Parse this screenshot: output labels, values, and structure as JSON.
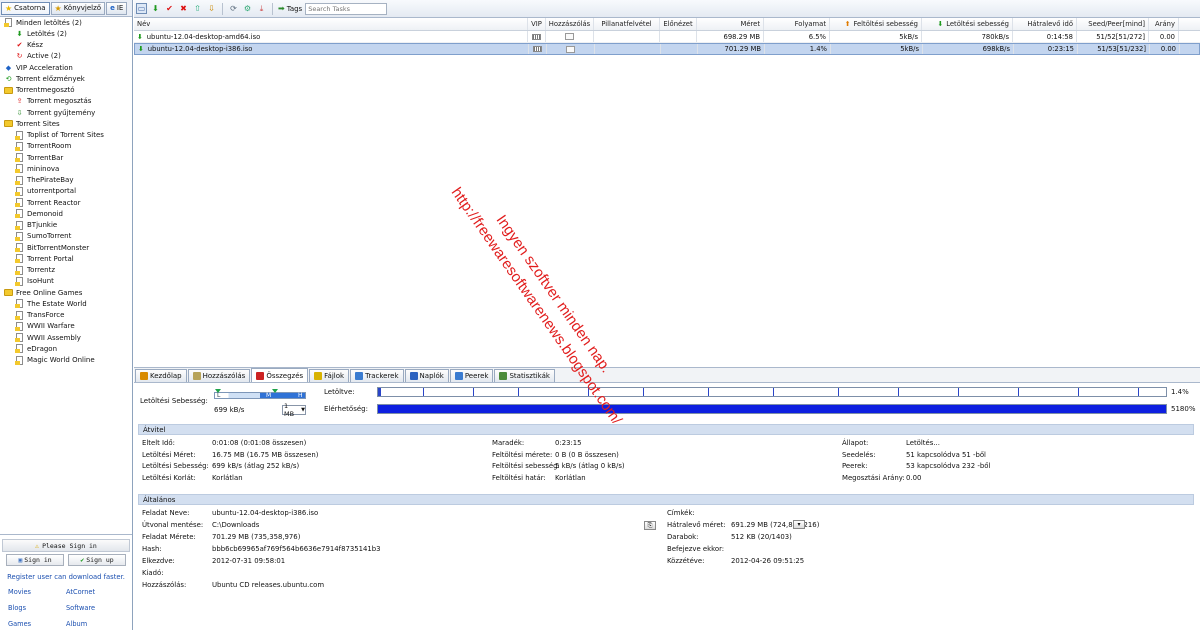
{
  "sidebar": {
    "tabs": [
      {
        "label": "Csatorna",
        "icon": "star-icon"
      },
      {
        "label": "Könyvjelző",
        "icon": "bookmark-icon"
      },
      {
        "label": "IE",
        "icon": "ie-icon"
      }
    ],
    "tree": [
      {
        "label": "Minden letöltés (2)",
        "level": 0,
        "icon": "page-icon"
      },
      {
        "label": "Letöltés (2)",
        "level": 1,
        "icon": "download-arrow-icon"
      },
      {
        "label": "Kész",
        "level": 1,
        "icon": "check-icon"
      },
      {
        "label": "Active (2)",
        "level": 1,
        "icon": "active-icon"
      },
      {
        "label": "VIP Acceleration",
        "level": 0,
        "icon": "vip-icon"
      },
      {
        "label": "Torrent előzmények",
        "level": 0,
        "icon": "history-icon"
      },
      {
        "label": "Torrentmegosztó",
        "level": 0,
        "icon": "folder-icon"
      },
      {
        "label": "Torrent megosztás",
        "level": 1,
        "icon": "share-icon"
      },
      {
        "label": "Torrent gyűjtemény",
        "level": 1,
        "icon": "collection-icon"
      },
      {
        "label": "Torrent Sites",
        "level": 0,
        "icon": "folder-icon"
      },
      {
        "label": "Toplist of Torrent Sites",
        "level": 1,
        "icon": "page-icon"
      },
      {
        "label": "TorrentRoom",
        "level": 1,
        "icon": "page-icon"
      },
      {
        "label": "TorrentBar",
        "level": 1,
        "icon": "page-icon"
      },
      {
        "label": "mininova",
        "level": 1,
        "icon": "page-icon"
      },
      {
        "label": "ThePirateBay",
        "level": 1,
        "icon": "page-icon"
      },
      {
        "label": "utorrentportal",
        "level": 1,
        "icon": "page-icon"
      },
      {
        "label": "Torrent Reactor",
        "level": 1,
        "icon": "page-icon"
      },
      {
        "label": "Demonoid",
        "level": 1,
        "icon": "page-icon"
      },
      {
        "label": "BTjunkie",
        "level": 1,
        "icon": "page-icon"
      },
      {
        "label": "SumoTorrent",
        "level": 1,
        "icon": "page-icon"
      },
      {
        "label": "BitTorrentMonster",
        "level": 1,
        "icon": "page-icon"
      },
      {
        "label": "Torrent Portal",
        "level": 1,
        "icon": "page-icon"
      },
      {
        "label": "Torrentz",
        "level": 1,
        "icon": "page-icon"
      },
      {
        "label": "IsoHunt",
        "level": 1,
        "icon": "page-icon"
      },
      {
        "label": "Free Online Games",
        "level": 0,
        "icon": "folder-icon"
      },
      {
        "label": "The Estate World",
        "level": 1,
        "icon": "page-icon"
      },
      {
        "label": "TransForce",
        "level": 1,
        "icon": "page-icon"
      },
      {
        "label": "WWII Warfare",
        "level": 1,
        "icon": "page-icon"
      },
      {
        "label": "WWII Assembly",
        "level": 1,
        "icon": "page-icon"
      },
      {
        "label": "eDragon",
        "level": 1,
        "icon": "page-icon"
      },
      {
        "label": "Magic World Online",
        "level": 1,
        "icon": "page-icon"
      }
    ],
    "signin": {
      "please": "Please Sign in",
      "sign_in": "Sign in",
      "sign_up": "Sign up",
      "register": "Register user can download faster.",
      "links": [
        "Movies",
        "AtCornet",
        "Blogs",
        "Software",
        "Games",
        "Album"
      ]
    }
  },
  "toolbar": {
    "tags_label": "Tags",
    "search_placeholder": "Search Tasks"
  },
  "tasklist": {
    "columns": [
      "Név",
      "VIP",
      "Hozzászólás",
      "Pillanatfelvétel",
      "Előnézet",
      "Méret",
      "Folyamat",
      "Feltöltési sebesség",
      "Letöltési sebesség",
      "Hátralevő idő",
      "Seed/Peer[mind]",
      "Arány"
    ],
    "rows": [
      {
        "name": "ubuntu-12.04-desktop-amd64.iso",
        "size": "698.29 MB",
        "progress": "6.5%",
        "up": "5kB/s",
        "down": "780kB/s",
        "remaining": "0:14:58",
        "seedpeer": "51/52[51/272]",
        "ratio": "0.00",
        "selected": false
      },
      {
        "name": "ubuntu-12.04-desktop-i386.iso",
        "size": "701.29 MB",
        "progress": "1.4%",
        "up": "5kB/s",
        "down": "698kB/s",
        "remaining": "0:23:15",
        "seedpeer": "51/53[51/232]",
        "ratio": "0.00",
        "selected": true
      }
    ]
  },
  "bottom": {
    "tabs": [
      "Kezdőlap",
      "Hozzászólás",
      "Összegzés",
      "Fájlok",
      "Trackerek",
      "Naplók",
      "Peerek",
      "Statisztikák"
    ],
    "active_tab": 2,
    "speed": {
      "label": "Letöltési Sebesség:",
      "slider_low": "L",
      "slider_mid": "M",
      "slider_high": "H",
      "value": "699 kB/s",
      "select": "1 MB"
    },
    "downloaded": {
      "label": "Letöltve:",
      "pct": "1.4%"
    },
    "availability": {
      "label": "Elérhetőség:",
      "pct": "5180%"
    },
    "transfer": {
      "title": "Átvitel",
      "col1": [
        {
          "k": "Eltelt Idő:",
          "v": "0:01:08 (0:01:08 összesen)"
        },
        {
          "k": "Letöltési Méret:",
          "v": "16.75 MB (16.75 MB összesen)"
        },
        {
          "k": "Letöltési Sebesség:",
          "v": "699 kB/s (átlag 252 kB/s)"
        },
        {
          "k": "Letöltési Korlát:",
          "v": "Korlátlan"
        }
      ],
      "col2": [
        {
          "k": "Maradék:",
          "v": "0:23:15"
        },
        {
          "k": "Feltöltési mérete:",
          "v": "0 B (0 B összesen)"
        },
        {
          "k": "Feltöltési sebesség:",
          "v": "5 kB/s (átlag 0 kB/s)"
        },
        {
          "k": "Feltöltési határ:",
          "v": "Korlátlan"
        }
      ],
      "col3": [
        {
          "k": "Állapot:",
          "v": "Letöltés..."
        },
        {
          "k": "Seedelés:",
          "v": "51 kapcsolódva 51 -ből"
        },
        {
          "k": "Peerek:",
          "v": "53 kapcsolódva 232 -ből"
        },
        {
          "k": "Megosztási Arány:",
          "v": "0.00"
        }
      ]
    },
    "general": {
      "title": "Általános",
      "col1": [
        {
          "k": "Feladat Neve:",
          "v": "ubuntu-12.04-desktop-i386.iso"
        },
        {
          "k": "Útvonal mentése:",
          "v": "C:\\Downloads"
        },
        {
          "k": "Feladat Mérete:",
          "v": "701.29 MB (735,358,976)"
        },
        {
          "k": "Hash:",
          "v": "bbb6cb69965af769f564b6636e7914f8735141b3"
        },
        {
          "k": "Elkezdve:",
          "v": "2012-07-31 09:58:01"
        },
        {
          "k": "Kiadó:",
          "v": ""
        },
        {
          "k": "Hozzászólás:",
          "v": "Ubuntu CD releases.ubuntu.com"
        }
      ],
      "col2": [
        {
          "k": "Címkék:",
          "v": ""
        },
        {
          "k": "Hátralevő méret:",
          "v": "691.29 MB (724,873,216)"
        },
        {
          "k": "Darabok:",
          "v": "512 KB (20/1403)"
        },
        {
          "k": "Befejezve ekkor:",
          "v": ""
        },
        {
          "k": "Közzétéve:",
          "v": "2012-04-26 09:51:25"
        }
      ]
    }
  },
  "watermark": {
    "line1": "Ingyen szoftver minden nap.",
    "line2": "http://freewaresoftwarenews.blogspot.com/"
  },
  "colors": {
    "selected_row": "#c3d5ef",
    "availability_fill": "#0d1fe0",
    "watermark": "#e11d1d"
  }
}
